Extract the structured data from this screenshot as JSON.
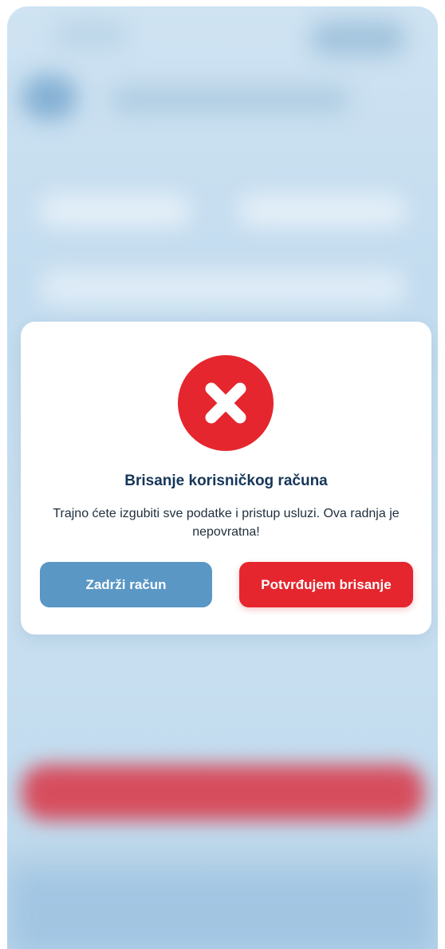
{
  "dialog": {
    "icon": "close-circle-icon",
    "title": "Brisanje korisničkog računa",
    "message": "Trajno ćete izgubiti sve podatke i pristup usluzi. Ova radnja je nepovratna!",
    "cancel_label": "Zadrži račun",
    "confirm_label": "Potvrđujem brisanje"
  },
  "colors": {
    "danger": "#e5262e",
    "primary": "#5a97c5",
    "title_text": "#16365a"
  }
}
